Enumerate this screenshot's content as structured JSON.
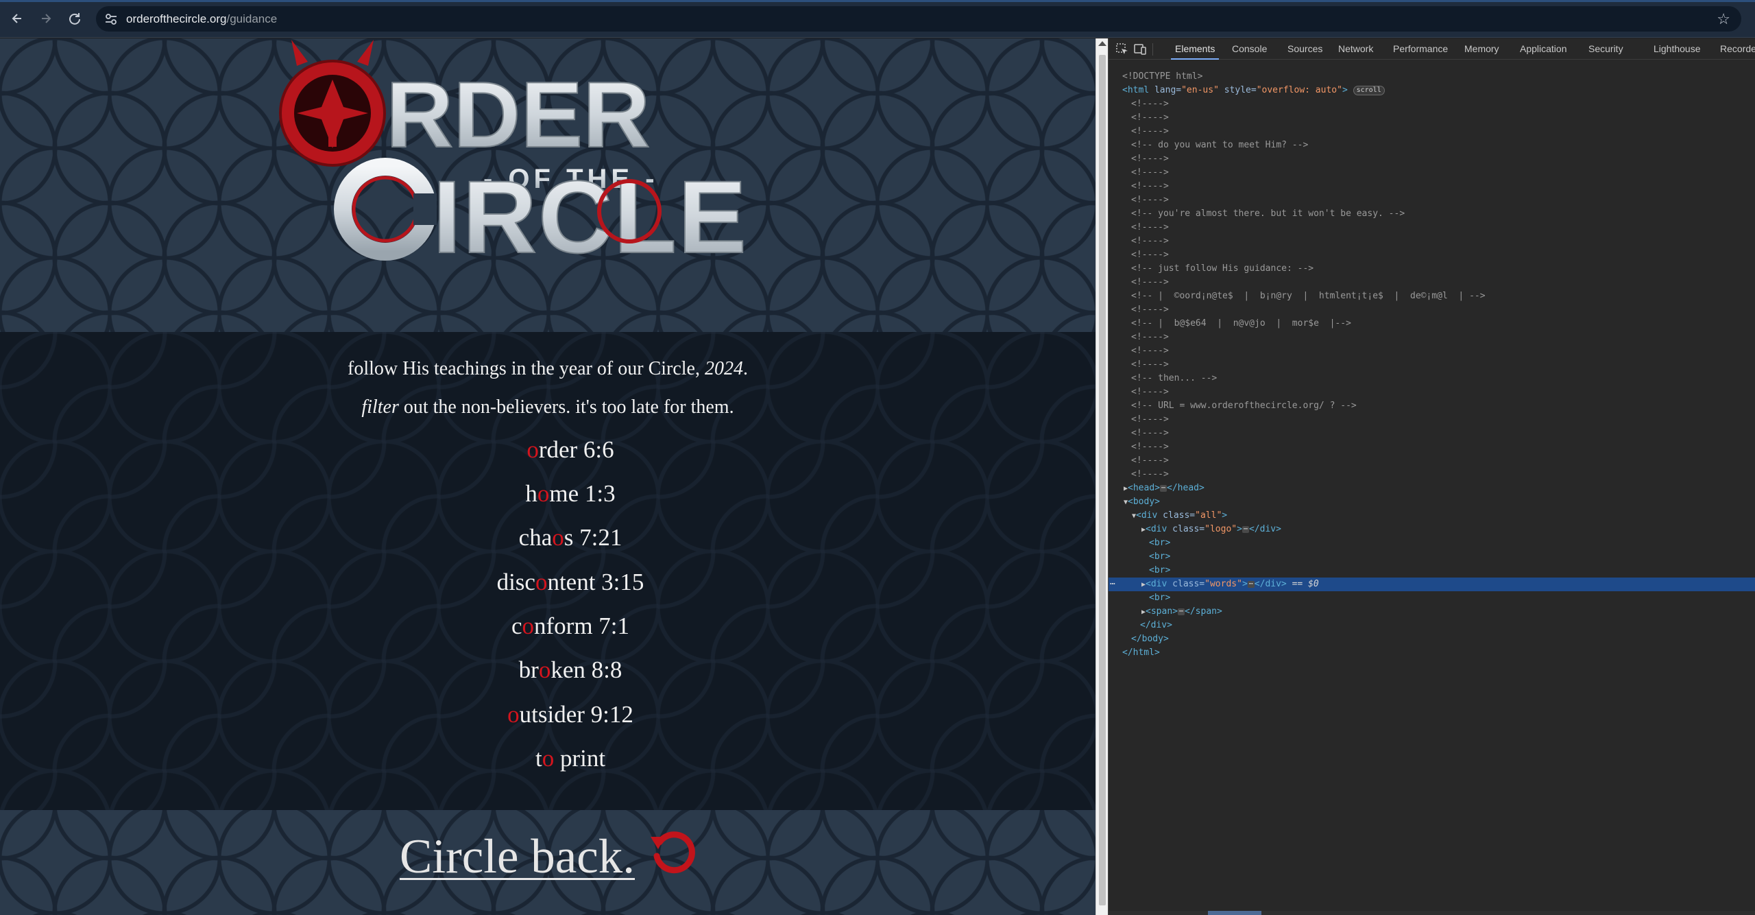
{
  "browser": {
    "url_domain": "orderofthecircle.org",
    "url_path": "/guidance"
  },
  "page": {
    "logo": {
      "word1_rest": "RDER",
      "word2": "- OF THE -",
      "word3_first": "C",
      "word3_rest": "IRCLE",
      "alt_text": "ORDER OF THE CIRCLE"
    },
    "intro_line1_pre": "follow His teachings in the year of our Circle, ",
    "intro_line1_year": "2024",
    "intro_line1_post": ".",
    "intro_line2_em": "filter",
    "intro_line2_rest": " out the non-believers. it's too late for them.",
    "verses": [
      {
        "pre": "",
        "red": "o",
        "post": "rder 6:6"
      },
      {
        "pre": "h",
        "red": "o",
        "post": "me 1:3"
      },
      {
        "pre": "cha",
        "red": "o",
        "post": "s 7:21"
      },
      {
        "pre": "disc",
        "red": "o",
        "post": "ntent 3:15"
      },
      {
        "pre": "c",
        "red": "o",
        "post": "nform 7:1"
      },
      {
        "pre": "br",
        "red": "o",
        "post": "ken 8:8"
      },
      {
        "pre": "",
        "red": "o",
        "post": "utsider 9:12"
      },
      {
        "pre": "t",
        "red": "o",
        "post": " print"
      }
    ],
    "circle_back": "Circle back."
  },
  "devtools": {
    "tabs": [
      "Elements",
      "Console",
      "Sources",
      "Network",
      "Performance",
      "Memory",
      "Application",
      "Security",
      "Lighthouse",
      "Recorde"
    ],
    "active_tab": "Elements",
    "dom": {
      "doctype": "<!DOCTYPE html>",
      "html_open_tag": "<html",
      "html_lang_attr": " lang=",
      "html_lang_val": "\"en-us\"",
      "html_style_attr": " style=",
      "html_style_val": "\"overflow: auto\"",
      "html_open_close": ">",
      "scroll_badge": "scroll",
      "empty_comment": "<!---->",
      "c_meet": "<!-- do you want to meet Him? -->",
      "c_almost": "<!-- you're almost there. but it won't be easy. -->",
      "c_follow": "<!-- just follow His guidance: -->",
      "c_list1": "<!-- |  ©oord¡n@te$  |  b¡n@ry  |  htmlent¡t¡e$  |  de©¡m@l  | -->",
      "c_list2": "<!-- |  b@$e64  |  n@v@jo  |  mor$e  |-->",
      "c_then": "<!-- then... -->",
      "c_url": "<!-- URL = www.orderofthecircle.org/ ? -->",
      "head_open": "<head>",
      "head_close": "</head>",
      "body_open": "<body>",
      "div_open": "<div",
      "class_attr": " class=",
      "all_val": "\"all\"",
      "logo_val": "\"logo\"",
      "words_val": "\"words\"",
      "div_close": "</div>",
      "br": "<br>",
      "span_open": "<span>",
      "span_close": "</span>",
      "body_close": "</body>",
      "html_close": "</html>",
      "ellipsis": "⋯",
      "sel_marker": "== $0",
      "gutter_dots": "⋯"
    }
  },
  "colors": {
    "accent_red": "#d4141d",
    "selection": "#1e4a8a",
    "page_bg": "#1c2736"
  },
  "icons": [
    "back-arrow-icon",
    "forward-arrow-icon",
    "reload-icon",
    "site-settings-icon",
    "bookmark-star-icon",
    "inspect-element-icon",
    "device-toolbar-icon",
    "circle-back-icon"
  ]
}
